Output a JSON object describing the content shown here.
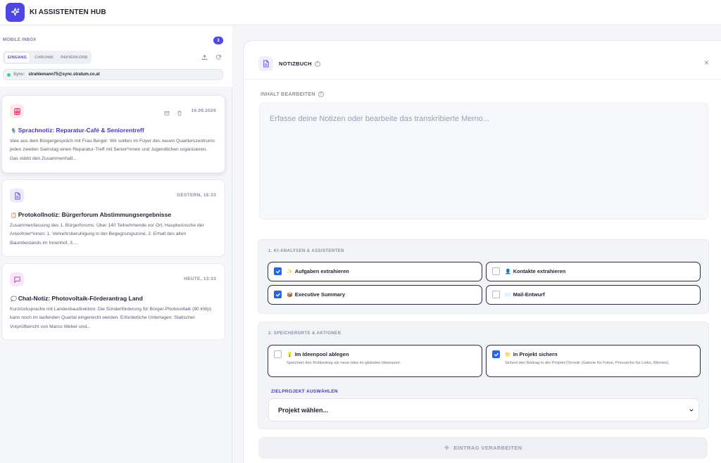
{
  "app": {
    "title": "KI ASSISTENTEN HUB"
  },
  "inbox": {
    "title": "MOBILE INBOX",
    "count": "3",
    "tabs": [
      {
        "label": "EINGANG",
        "active": true
      },
      {
        "label": "CHRONIK",
        "active": false
      },
      {
        "label": "PAPIERKORB",
        "active": false
      }
    ],
    "sync": {
      "label": "Sync:",
      "email": "strahlemann75@sync.stratum.co.at"
    },
    "items": [
      {
        "icon": "voice-memo-icon",
        "date": "16.09.2026",
        "emoji": "🎙️",
        "title": "Sprachnotiz: Reparatur-Café & Seniorentreff",
        "text": "Idee aus dem Bürgergespräch mit Frau Berger: Wir sollten im Foyer des neuen Quartierszentrums jeden zweiten Samstag einen Reparatur-Treff mit Senior*innen und Jugendlichen organisieren. Das stärkt den Zusammenhalt..."
      },
      {
        "icon": "document-icon",
        "date": "GESTERN, 16:33",
        "emoji": "📋",
        "title": "Protokollnotiz: Bürgerforum Abstimmungsergebnisse",
        "text": "Zusammenfassung des 1. Bürgerforums: Über 140 Teilnehmende vor Ort. Hauptwünsche der Anwohner*innen: 1. Verkehrsberuhigung in der Begegnungszone, 2. Erhalt des alten Baumbestands im Innenhof, 3...."
      },
      {
        "icon": "chat-icon",
        "date": "HEUTE, 13:33",
        "emoji": "💭",
        "title": "Chat-Notiz: Photovoltaik-Förderantrag Land",
        "text": "Kurzrücksprache mit Landesbaudirektion: Die Sonderförderung für Bürger-Photovoltaik (80 kWp) kann noch im laufenden Quartal eingereicht werden. Erforderliche Unterlagen: Statischer Vorprüfbericht von Marco Weber und..."
      }
    ]
  },
  "notebook": {
    "title": "NOTIZBUCH",
    "content_label": "INHALT BEARBEITEN",
    "placeholder": "Erfasse deine Notizen oder bearbeite das transkribierte Memo...",
    "section1": {
      "title": "1. KI-ANALYSEN & ASSISTENTEN",
      "options": [
        {
          "emoji": "✨",
          "label": "Aufgaben extrahieren",
          "checked": true
        },
        {
          "emoji": "👤",
          "label": "Kontakte extrahieren",
          "checked": false
        },
        {
          "emoji": "📦",
          "label": "Executive Summary",
          "checked": true
        },
        {
          "emoji": "✉️",
          "label": "Mail-Entwurf",
          "checked": false
        }
      ]
    },
    "section2": {
      "title": "2. SPEICHERORTE & AKTIONEN",
      "options": [
        {
          "emoji": "💡",
          "label": "Im Ideenpool ablegen",
          "desc": "Speichert den Rohbeitrag als neue Idee im globalen Ideenpool.",
          "checked": false
        },
        {
          "emoji": "📁",
          "label": "In Projekt sichern",
          "desc": "Sichert den Beitrag in der Projekt-Chronik (Galerie für Fotos, Pressecho für Links, Memos).",
          "checked": true
        }
      ],
      "target_label": "ZIELPROJEKT AUSWÄHLEN",
      "select_value": "Projekt wählen..."
    },
    "process_button": "EINTRAG VERARBEITEN"
  },
  "colors": {
    "accent": "#4f46e5",
    "checkbox": "#2563eb"
  }
}
